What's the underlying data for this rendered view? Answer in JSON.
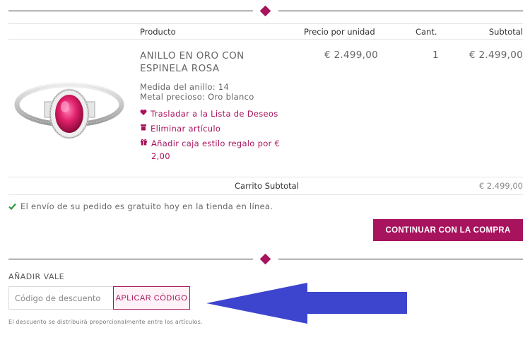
{
  "table": {
    "headers": {
      "product": "Producto",
      "unit_price": "Precio por unidad",
      "qty": "Cant.",
      "subtotal": "Subtotal"
    }
  },
  "item": {
    "name": "ANILLO EN ORO CON ESPINELA ROSA",
    "unit_price": "€ 2.499,00",
    "qty": "1",
    "subtotal": "€ 2.499,00",
    "ring_size": "Medida del anillo: 14",
    "metal": "Metal precioso: Oro blanco",
    "image_icon": "ring-image",
    "actions": {
      "wishlist": "Trasladar a la Lista de Deseos",
      "remove": "Eliminar artículo",
      "gift_box": "Añadir caja estilo regalo por € 2,00"
    }
  },
  "cart": {
    "subtotal_label": "Carrito Subtotal",
    "subtotal_value": "€ 2.499,00"
  },
  "shipping_message": "El envío de su pedido es gratuito hoy en la tienda en línea.",
  "checkout_button": "CONTINUAR CON LA COMPRA",
  "voucher": {
    "title": "AÑADIR VALE",
    "placeholder": "Código de descuento",
    "apply_button": "APLICAR CÓDIGO",
    "note": "El descuento se distribuirá proporcionalmente entre los artículos."
  },
  "colors": {
    "accent": "#a8135e",
    "check": "#2e9a3e",
    "arrow": "#3d45cf"
  }
}
